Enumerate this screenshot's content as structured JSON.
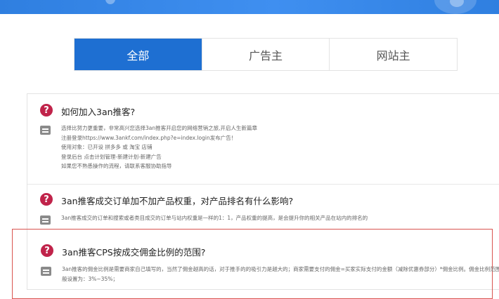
{
  "tabs": [
    {
      "label": "全部",
      "active": true
    },
    {
      "label": "广告主",
      "active": false
    },
    {
      "label": "网站主",
      "active": false
    }
  ],
  "faq": [
    {
      "question": "如何加入3an推客?",
      "answer_lines": [
        "选择比努力更重要，非常高兴您选择3an推客开启您的网络营销之旅,开启人生新篇章",
        "注册登录https://www.3ankf.com/index.php?e=index.login发布广告！",
        "使用对象：已开设 拼多多 或 淘宝 店铺",
        "登录后台 点击计划管理-新建计划-新建广告",
        "如果您不熟悉操作的流程，请联系客服协助指导"
      ]
    },
    {
      "question": "3an推客成交订单加不加产品权重，对产品排名有什么影响?",
      "answer_lines": [
        "3an推客成交的订单和搜索或者类目成交的订单与站内权重是一样的1：1，产品权重的提高，是会提升你的相关产品在站内的排名的"
      ]
    },
    {
      "question": "3an推客CPS按成交佣金比例的范围?",
      "answer_lines": [
        "3an推客的佣金比例是需要商家自己填写的，当然了佣金越高的话，对于推手的的吸引力是越大的；商家需要支付的佣金=买家实际支付的金额（减除优惠券部分）*佣金比例。佣金比例范围一",
        "般设置为：3%~35%；"
      ]
    }
  ],
  "colors": {
    "accent": "#1e6fd2",
    "question_icon": "#c0234a",
    "highlight_border": "#d9534f"
  },
  "icons": {
    "question": "question-mark-icon",
    "answer": "answer-lines-icon"
  }
}
